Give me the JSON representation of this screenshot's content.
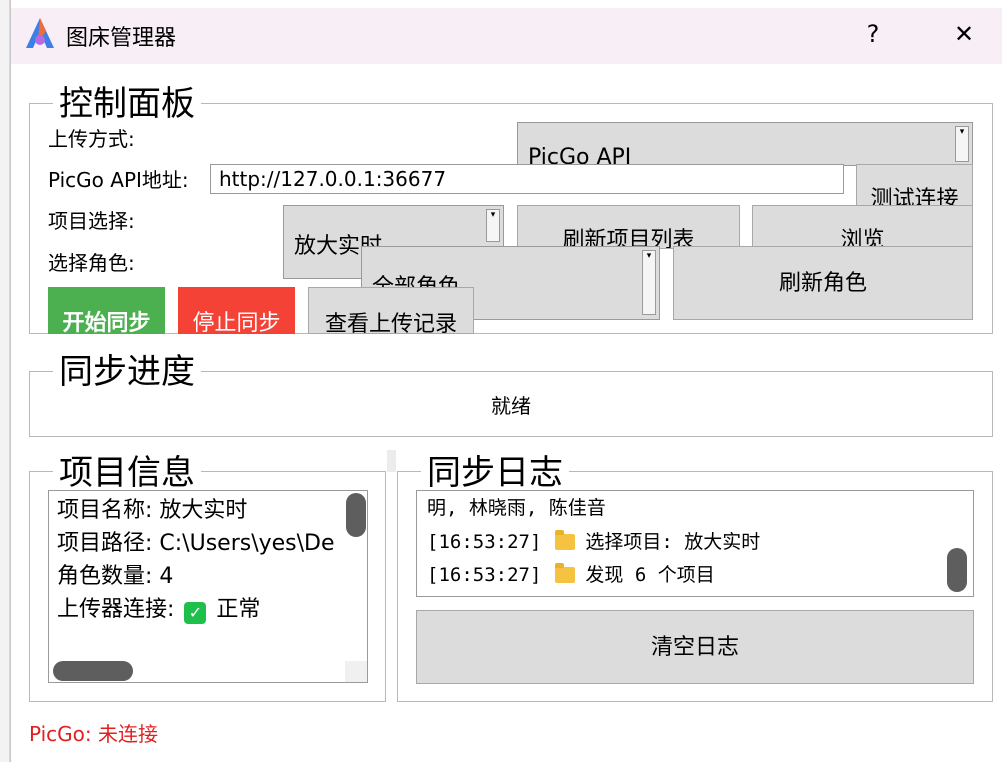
{
  "window": {
    "title": "图床管理器",
    "help_label": "?",
    "close_label": "✕"
  },
  "control_panel": {
    "title": "控制面板",
    "upload_method_label": "上传方式:",
    "upload_method_value": "PicGo API",
    "api_label": "PicGo API地址:",
    "api_value": "http://127.0.0.1:36677",
    "test_button": "测试连接",
    "project_label": "项目选择:",
    "project_value": "放大实时",
    "refresh_projects_button": "刷新项目列表",
    "browse_button": "浏览",
    "role_label": "选择角色:",
    "role_value": "全部角色",
    "refresh_roles_button": "刷新角色",
    "start_button": "开始同步",
    "stop_button": "停止同步",
    "history_button": "查看上传记录"
  },
  "progress": {
    "title": "同步进度",
    "status_text": "就绪"
  },
  "project_info": {
    "title": "项目信息",
    "name_line": "项目名称: 放大实时",
    "path_line": "项目路径: C:\\Users\\yes\\De",
    "role_count_line": "角色数量: 4",
    "uploader_label": "上传器连接:",
    "uploader_value": "正常"
  },
  "sync_log": {
    "title": "同步日志",
    "line1": "明, 林晓雨, 陈佳音",
    "line2_time": "[16:53:27]",
    "line2_text": "选择项目: 放大实时",
    "line3_time": "[16:53:27]",
    "line3_text": "发现 6 个项目",
    "clear_button": "清空日志"
  },
  "footer": {
    "status": "PicGo: 未连接"
  },
  "colors": {
    "start": "#4caf50",
    "stop": "#f44336",
    "status_error": "#e02020",
    "title_bar": "#f7eef6"
  },
  "icons": [
    "app-logo-icon",
    "help-icon",
    "close-icon",
    "folder-icon",
    "check-icon",
    "chevron-down-icon"
  ]
}
